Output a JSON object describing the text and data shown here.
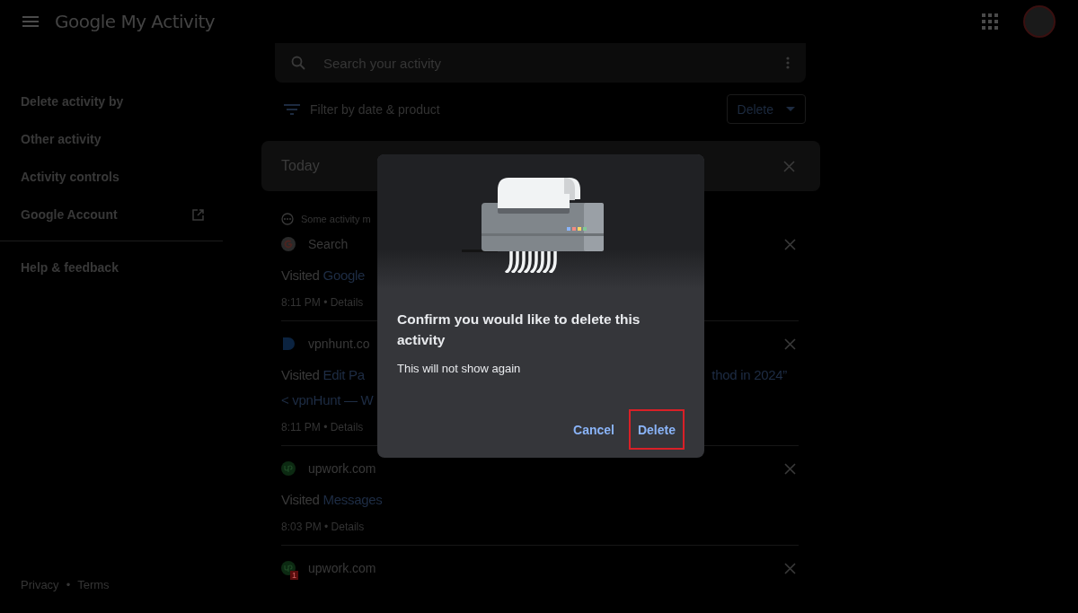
{
  "header": {
    "title": "Google My Activity"
  },
  "sidebar": {
    "items": [
      {
        "label": "Delete activity by",
        "external": false
      },
      {
        "label": "Other activity",
        "external": false
      },
      {
        "label": "Activity controls",
        "external": false
      },
      {
        "label": "Google Account",
        "external": true
      }
    ],
    "secondary": [
      {
        "label": "Help & feedback"
      }
    ],
    "footer": [
      "Privacy",
      "•",
      "Terms"
    ]
  },
  "search": {
    "placeholder": "Search your activity"
  },
  "filter": {
    "label": "Filter by date & product"
  },
  "delete_menu": {
    "label": "Delete"
  },
  "day": {
    "label": "Today"
  },
  "notice": {
    "text": "Some activity m"
  },
  "items": [
    {
      "kind": "google",
      "source": "Search",
      "lines": [
        {
          "segments": [
            {
              "text": "Visited ",
              "link": false
            },
            {
              "text": "Google",
              "link": true
            }
          ]
        }
      ],
      "meta": "8:11 PM • Details"
    },
    {
      "kind": "vpnhunt",
      "source": "vpnhunt.co",
      "lines": [
        {
          "segments": [
            {
              "text": "Visited ",
              "link": false
            },
            {
              "text": "Edit Pa",
              "link": true
            }
          ],
          "tail": "thod in 2024”"
        },
        {
          "segments": [
            {
              "text": "< vpnHunt — W",
              "link": true
            }
          ]
        }
      ],
      "meta": "8:11 PM • Details"
    },
    {
      "kind": "upwork",
      "source": "upwork.com",
      "lines": [
        {
          "segments": [
            {
              "text": "Visited ",
              "link": false
            },
            {
              "text": "Messages",
              "link": true
            }
          ]
        }
      ],
      "meta": "8:03 PM • Details"
    },
    {
      "kind": "upwork",
      "source": "upwork.com",
      "badge": "1"
    }
  ],
  "dialog": {
    "title": "Confirm you would like to delete this activity",
    "body": "This will not show again",
    "actions": [
      {
        "label": "Cancel",
        "highlighted": false
      },
      {
        "label": "Delete",
        "highlighted": true
      }
    ]
  }
}
